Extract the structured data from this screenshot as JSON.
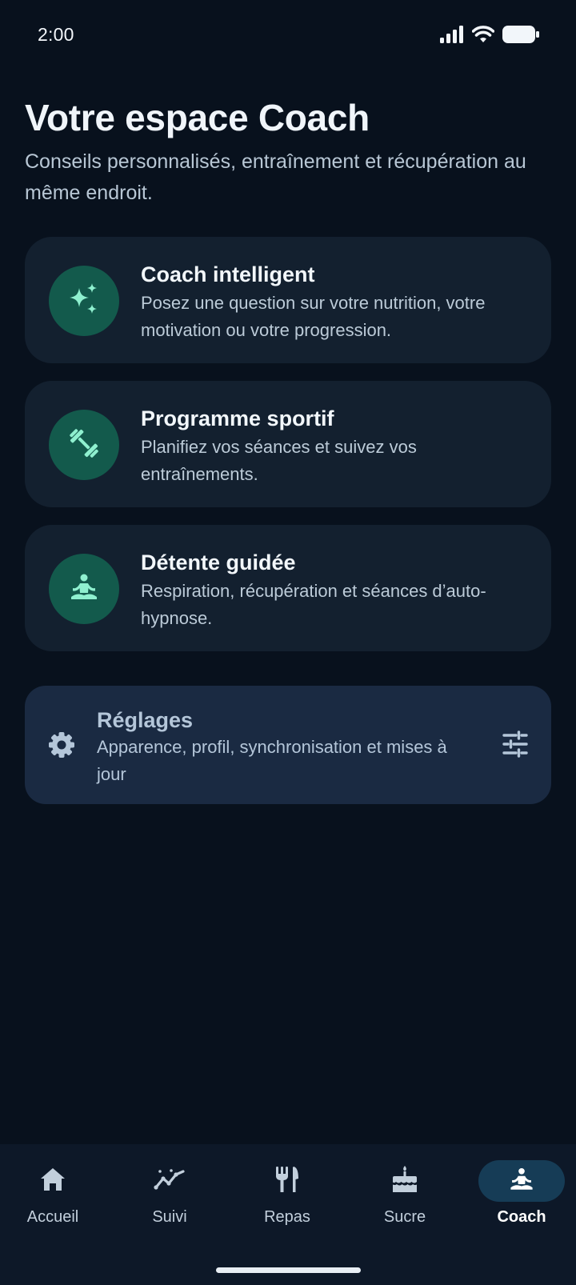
{
  "status_bar": {
    "time": "2:00"
  },
  "header": {
    "title": "Votre espace Coach",
    "subtitle": "Conseils personnalisés, entraînement et récupération au même endroit."
  },
  "cards": [
    {
      "title": "Coach intelligent",
      "description": "Posez une question sur votre nutrition, votre motivation ou votre progression.",
      "icon": "sparkles-icon"
    },
    {
      "title": "Programme sportif",
      "description": "Planifiez vos séances et suivez vos entraînements.",
      "icon": "dumbbell-icon"
    },
    {
      "title": "Détente guidée",
      "description": "Respiration, récupération et séances d’auto-hypnose.",
      "icon": "meditation-icon"
    }
  ],
  "settings": {
    "title": "Réglages",
    "description": "Apparence, profil, synchronisation et mises à jour",
    "icon": "gear-icon",
    "action_icon": "tune-icon"
  },
  "bottom_nav": {
    "items": [
      {
        "label": "Accueil",
        "icon": "home-icon"
      },
      {
        "label": "Suivi",
        "icon": "trend-icon"
      },
      {
        "label": "Repas",
        "icon": "utensils-icon"
      },
      {
        "label": "Sucre",
        "icon": "cake-icon"
      },
      {
        "label": "Coach",
        "icon": "meditation-icon"
      }
    ],
    "active": "Coach"
  },
  "colors": {
    "background": "#08111d",
    "card": "#13202f",
    "icon_circle": "#135a4c",
    "icon_glyph": "#8ff0cf",
    "settings_card": "#1a2a42",
    "nav_active_pill": "#163c56"
  }
}
